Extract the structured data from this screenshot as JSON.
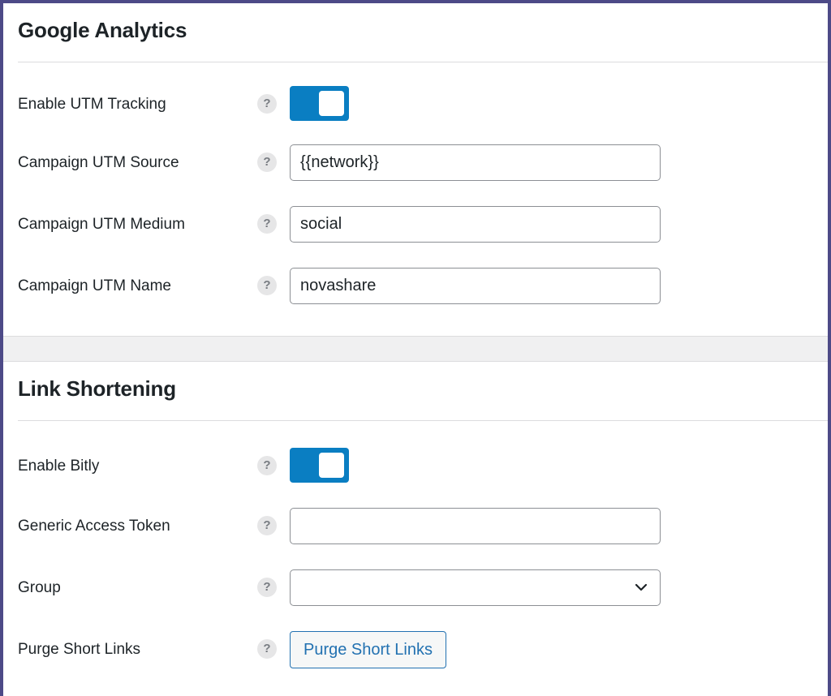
{
  "google_analytics": {
    "title": "Google Analytics",
    "rows": [
      {
        "label": "Enable UTM Tracking",
        "help": "?",
        "type": "toggle",
        "enabled": true
      },
      {
        "label": "Campaign UTM Source",
        "help": "?",
        "type": "input",
        "value": "{{network}}"
      },
      {
        "label": "Campaign UTM Medium",
        "help": "?",
        "type": "input",
        "value": "social"
      },
      {
        "label": "Campaign UTM Name",
        "help": "?",
        "type": "input",
        "value": "novashare"
      }
    ]
  },
  "link_shortening": {
    "title": "Link Shortening",
    "rows": [
      {
        "label": "Enable Bitly",
        "help": "?",
        "type": "toggle",
        "enabled": true
      },
      {
        "label": "Generic Access Token",
        "help": "?",
        "type": "input",
        "value": ""
      },
      {
        "label": "Group",
        "help": "?",
        "type": "select",
        "value": ""
      },
      {
        "label": "Purge Short Links",
        "help": "?",
        "type": "button",
        "button_label": "Purge Short Links"
      }
    ]
  },
  "icons": {
    "help": "help-circle-icon",
    "dropdown": "chevron-down-icon"
  },
  "colors": {
    "toggle_on": "#0a7ec2",
    "link_button": "#2271b1",
    "frame_border": "#4d4a87",
    "section_gap": "#f0f0f1"
  }
}
